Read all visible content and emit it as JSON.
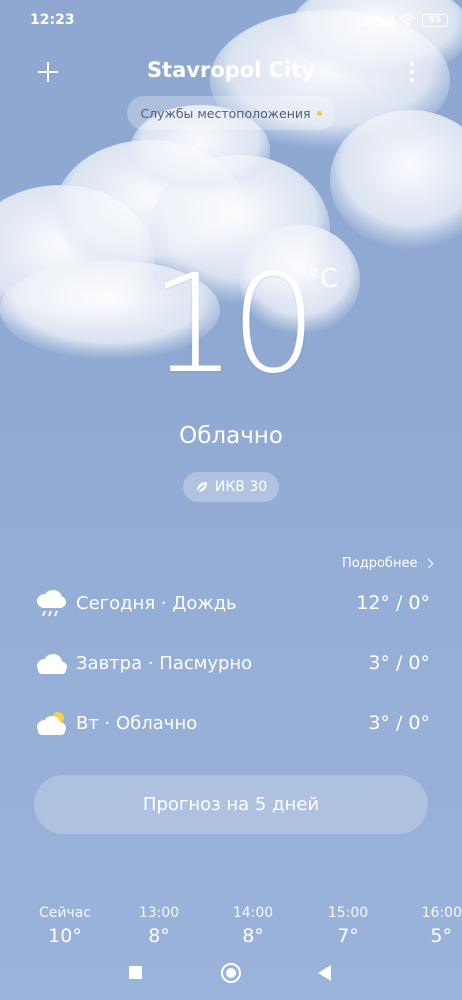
{
  "status_bar": {
    "time": "12:23",
    "battery": "65",
    "icons": [
      "signal-icon",
      "signal-icon",
      "wifi-icon",
      "battery-icon"
    ]
  },
  "header": {
    "city": "Stavropol City",
    "add_icon": "plus-icon",
    "menu_icon": "more-vertical-icon"
  },
  "location_services": {
    "label": "Службы местоположения",
    "dot_color": "#f5c84a"
  },
  "current": {
    "temperature": "10",
    "unit": "°C",
    "condition": "Облачно",
    "aqi_label": "ИКВ 30",
    "aqi_icon": "leaf-icon"
  },
  "forecast": {
    "details_label": "Подробнее",
    "days": [
      {
        "label": "Сегодня · Дождь",
        "temps": "12° / 0°",
        "icon": "rain-cloud-icon"
      },
      {
        "label": "Завтра · Пасмурно",
        "temps": "3° / 0°",
        "icon": "cloud-icon"
      },
      {
        "label": "Вт · Облачно",
        "temps": "3° / 0°",
        "icon": "partly-cloudy-icon"
      }
    ]
  },
  "five_day_button": "Прогноз на 5 дней",
  "hourly": [
    {
      "time": "Сейчас",
      "temp": "10°"
    },
    {
      "time": "13:00",
      "temp": "8°"
    },
    {
      "time": "14:00",
      "temp": "8°"
    },
    {
      "time": "15:00",
      "temp": "7°"
    },
    {
      "time": "16:00",
      "temp": "5°"
    }
  ],
  "nav": {
    "recents_icon": "square-icon",
    "home_icon": "circle-home-icon",
    "back_icon": "back-triangle-icon"
  },
  "colors": {
    "sky_top": "#8ea8d2",
    "sky_bottom": "#9ab3da",
    "text": "#ffffff"
  }
}
